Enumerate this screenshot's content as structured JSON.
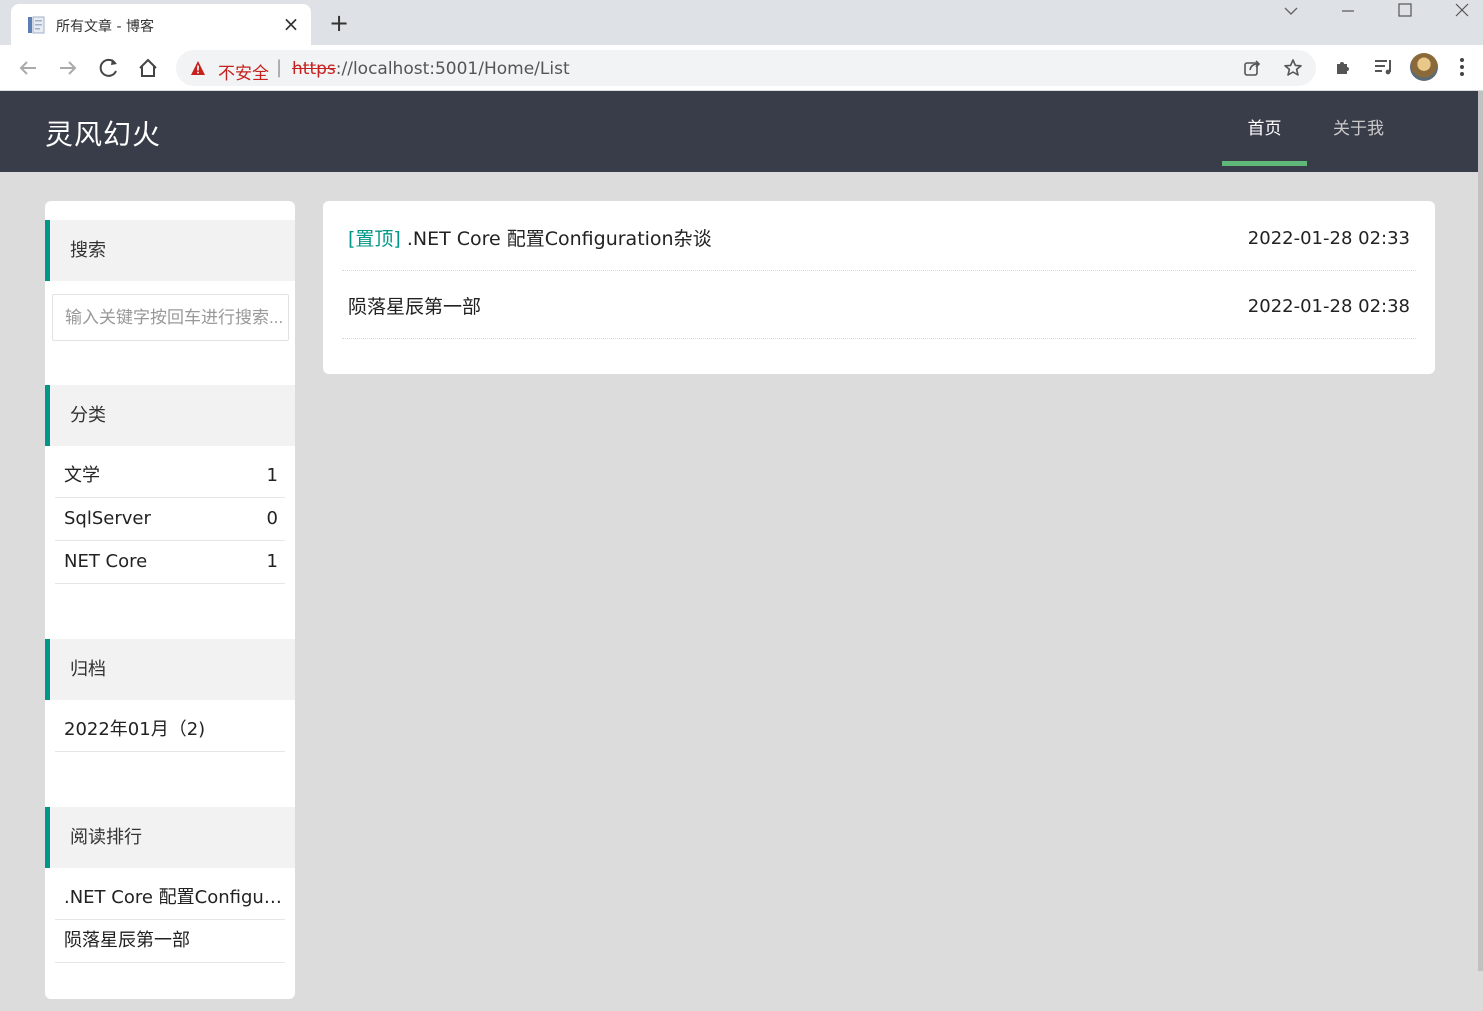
{
  "browser": {
    "tab_title": "所有文章 - 博客",
    "url_insecure_label": "不安全",
    "url_scheme": "https",
    "url_rest": "://localhost:5001/Home/List"
  },
  "site": {
    "logo": "灵风幻火",
    "nav": [
      {
        "label": "首页",
        "active": true
      },
      {
        "label": "关于我",
        "active": false
      }
    ]
  },
  "sidebar": {
    "search": {
      "title": "搜索",
      "placeholder": "输入关键字按回车进行搜索..."
    },
    "categories": {
      "title": "分类",
      "items": [
        {
          "name": "文学",
          "count": "1"
        },
        {
          "name": "SqlServer",
          "count": "0"
        },
        {
          "name": "NET Core",
          "count": "1"
        }
      ]
    },
    "archive": {
      "title": "归档",
      "items": [
        {
          "label": "2022年01月（2)"
        }
      ]
    },
    "ranking": {
      "title": "阅读排行",
      "items": [
        {
          "label": ".NET Core 配置Configuration杂谈"
        },
        {
          "label": "陨落星辰第一部"
        }
      ]
    }
  },
  "articles": [
    {
      "tag": "[置顶]",
      "title": ".NET Core 配置Configuration杂谈",
      "date": "2022-01-28 02:33"
    },
    {
      "tag": "",
      "title": "陨落星辰第一部",
      "date": "2022-01-28 02:38"
    }
  ],
  "colors": {
    "header_bg": "#393d49",
    "accent": "#009688",
    "nav_active_bar": "#5fb878",
    "insecure_red": "#c5221f"
  }
}
